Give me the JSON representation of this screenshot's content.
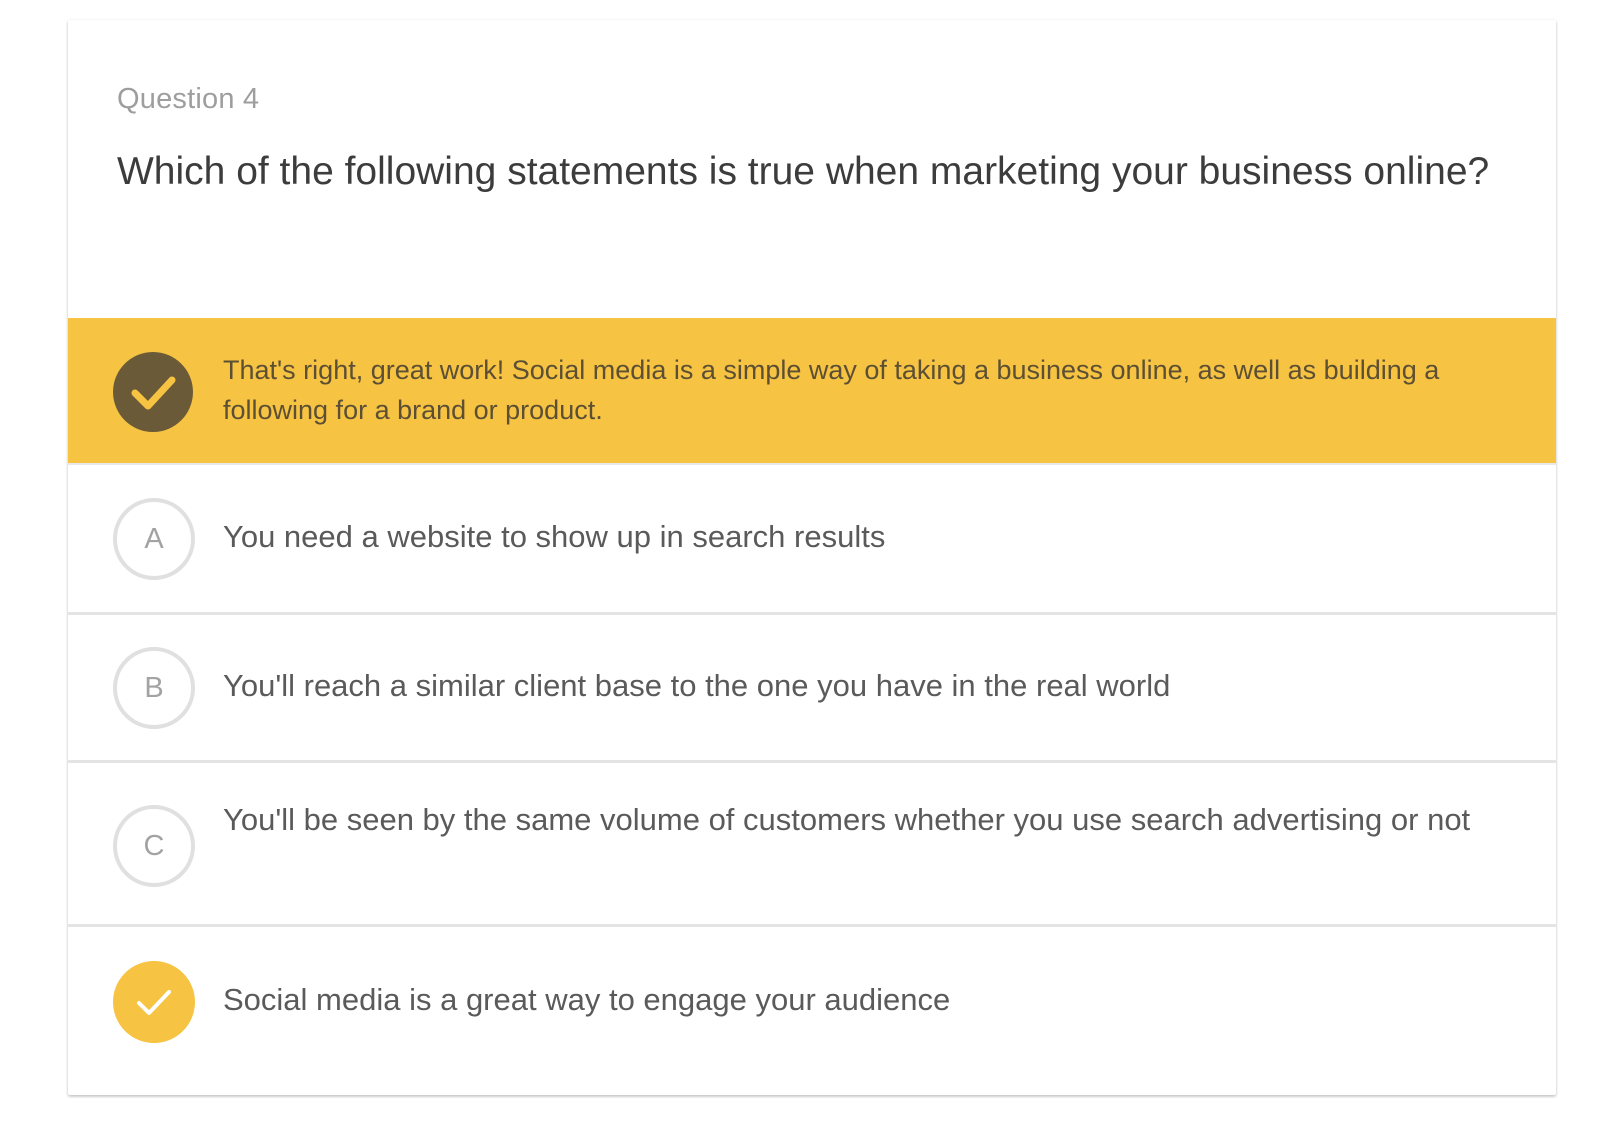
{
  "question": {
    "number_label": "Question 4",
    "text": "Which of the following statements is true when marketing your business online?"
  },
  "feedback": {
    "icon": "checkmark-icon",
    "text": "That's right, great work! Social media is a simple way of taking a business online, as well as building a following for a brand or product.",
    "background_color": "#f6c342",
    "icon_color": "#6b5a37"
  },
  "options": [
    {
      "letter": "A",
      "text": "You need a website to show up in search results",
      "state": "unselected"
    },
    {
      "letter": "B",
      "text": "You'll reach a similar client base to the one you have in the real world",
      "state": "unselected"
    },
    {
      "letter": "C",
      "text": "You'll be seen by the same volume of customers whether you use search advertising or not",
      "state": "unselected"
    },
    {
      "letter": "",
      "icon": "checkmark-icon",
      "text": "Social media is a great way to engage your audience",
      "state": "correct"
    }
  ]
}
